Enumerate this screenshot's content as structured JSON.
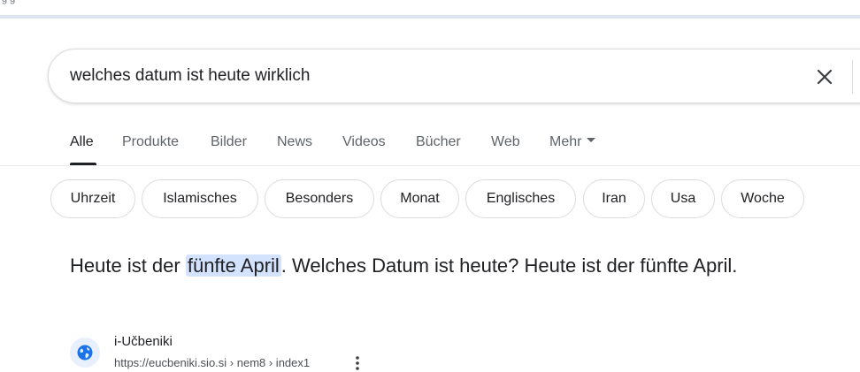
{
  "search": {
    "query": "welches datum ist heute wirklich"
  },
  "tabs": [
    {
      "label": "Alle",
      "active": true
    },
    {
      "label": "Produkte",
      "active": false
    },
    {
      "label": "Bilder",
      "active": false
    },
    {
      "label": "News",
      "active": false
    },
    {
      "label": "Videos",
      "active": false
    },
    {
      "label": "Bücher",
      "active": false
    },
    {
      "label": "Web",
      "active": false
    },
    {
      "label": "Mehr",
      "active": false
    }
  ],
  "chips": [
    {
      "label": "Uhrzeit"
    },
    {
      "label": "Islamisches"
    },
    {
      "label": "Besonders"
    },
    {
      "label": "Monat"
    },
    {
      "label": "Englisches"
    },
    {
      "label": "Iran"
    },
    {
      "label": "Usa"
    },
    {
      "label": "Woche"
    }
  ],
  "answer": {
    "before": "Heute ist der ",
    "highlight": "fünfte April",
    "after": ". Welches Datum ist heute? Heute ist der fünfte April."
  },
  "source": {
    "name": "i-Učbeniki",
    "url": "https://eucbeniki.sio.si › nem8 › index1"
  },
  "icons": {
    "clear": "close-icon",
    "source": "globe-icon",
    "more": "more-vert-icon",
    "caret": "caret-down-icon"
  },
  "colors": {
    "highlight": "#d3e3fd",
    "text": "#202124",
    "muted": "#5f6368",
    "globe": "#1a73e8"
  }
}
